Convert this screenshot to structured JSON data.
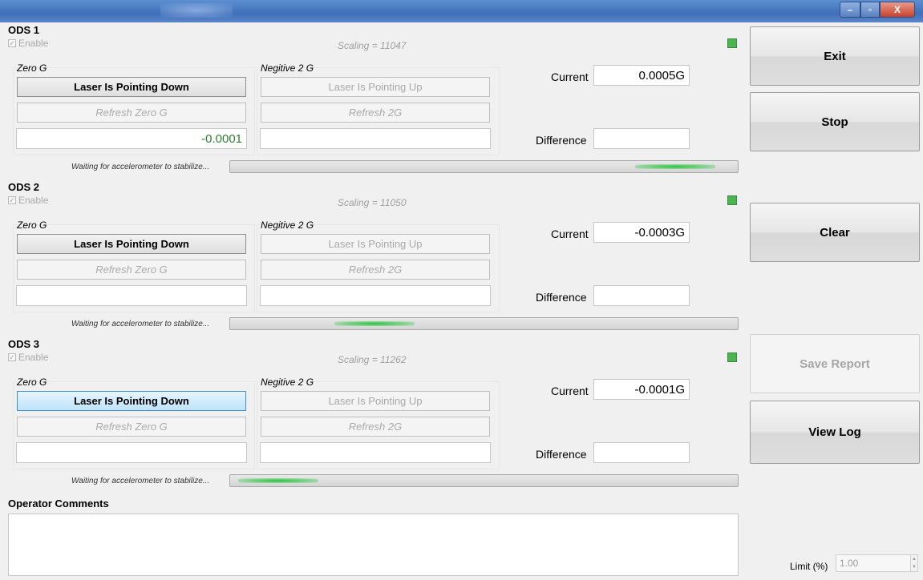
{
  "window": {
    "controls": {
      "minimize": "–",
      "maximize": "▫",
      "close": "X"
    }
  },
  "ods": [
    {
      "title": "ODS 1",
      "enable_label": "Enable",
      "scaling": "Scaling = 11047",
      "zero_g_label": "Zero G",
      "neg2g_label": "Negitive 2 G",
      "laser_down_label": "Laser Is Pointing Down",
      "laser_up_label": "Laser Is Pointing Up",
      "refresh_zero_label": "Refresh Zero G",
      "refresh_2g_label": "Refresh 2G",
      "zero_value": "-0.0001",
      "neg2g_value": "",
      "current_label": "Current",
      "current_value": "0.0005G",
      "difference_label": "Difference",
      "difference_value": "",
      "status": "Waiting for accelerometer to stabilize..."
    },
    {
      "title": "ODS 2",
      "enable_label": "Enable",
      "scaling": "Scaling = 11050",
      "zero_g_label": "Zero G",
      "neg2g_label": "Negitive 2 G",
      "laser_down_label": "Laser Is Pointing Down",
      "laser_up_label": "Laser Is Pointing Up",
      "refresh_zero_label": "Refresh Zero G",
      "refresh_2g_label": "Refresh 2G",
      "zero_value": "",
      "neg2g_value": "",
      "current_label": "Current",
      "current_value": "-0.0003G",
      "difference_label": "Difference",
      "difference_value": "",
      "status": "Waiting for accelerometer to stabilize..."
    },
    {
      "title": "ODS 3",
      "enable_label": "Enable",
      "scaling": "Scaling = 11262",
      "zero_g_label": "Zero G",
      "neg2g_label": "Negitive 2 G",
      "laser_down_label": "Laser Is Pointing Down",
      "laser_up_label": "Laser Is Pointing Up",
      "refresh_zero_label": "Refresh Zero G",
      "refresh_2g_label": "Refresh 2G",
      "zero_value": "",
      "neg2g_value": "",
      "current_label": "Current",
      "current_value": "-0.0001G",
      "difference_label": "Difference",
      "difference_value": "",
      "status": "Waiting for accelerometer to stabilize..."
    }
  ],
  "actions": {
    "exit": "Exit",
    "stop": "Stop",
    "clear": "Clear",
    "save_report": "Save Report",
    "view_log": "View Log"
  },
  "comments": {
    "title": "Operator Comments",
    "value": ""
  },
  "limit": {
    "label": "Limit (%)",
    "value": "1.00"
  },
  "colors": {
    "led": "#4cb552",
    "progress": "#24c63a",
    "title_bar": "#4a7cc2"
  }
}
